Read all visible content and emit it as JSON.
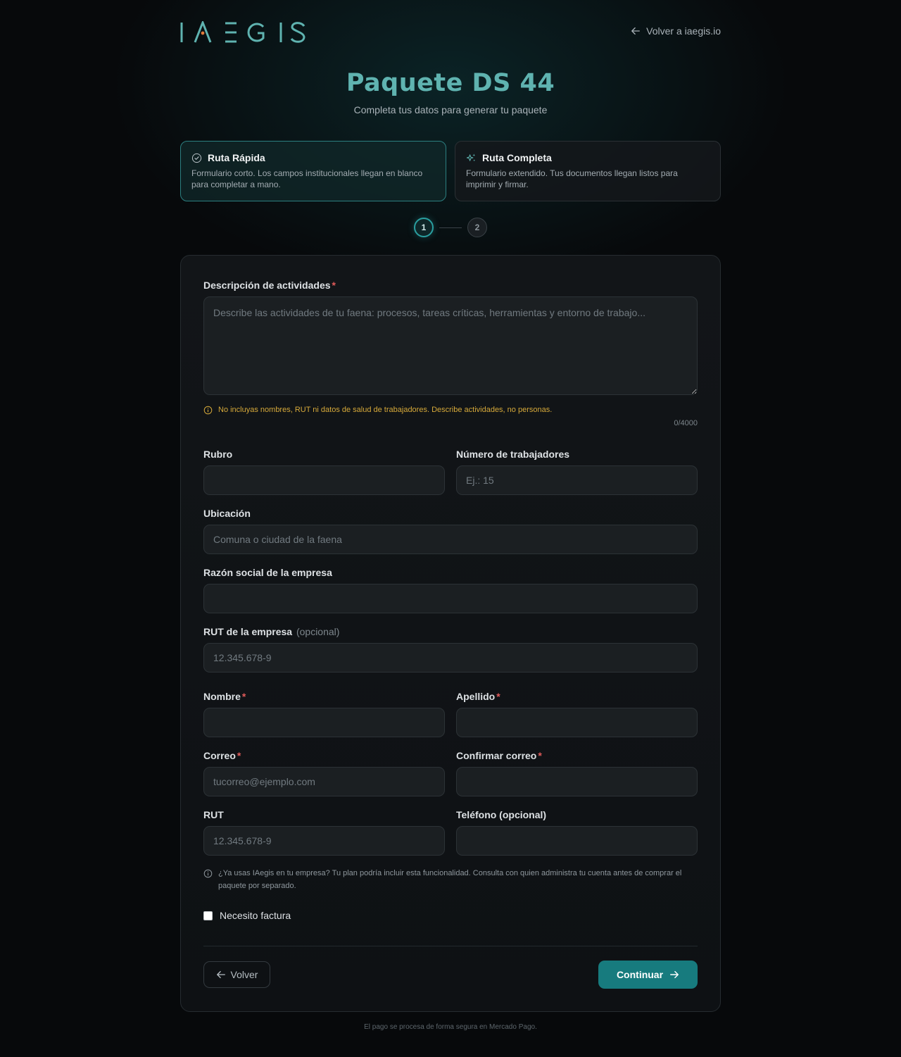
{
  "header": {
    "logo_text": "IAEGIS",
    "back_link": "Volver a iaegis.io"
  },
  "title": "Paquete DS 44",
  "subtitle": "Completa tus datos para generar tu paquete",
  "routes": [
    {
      "title": "Ruta Rápida",
      "description": "Formulario corto. Los campos institucionales llegan en blanco para completar a mano.",
      "icon": "check-circle-icon",
      "selected": true
    },
    {
      "title": "Ruta Completa",
      "description": "Formulario extendido. Tus documentos llegan listos para imprimir y firmar.",
      "icon": "sparkles-icon",
      "selected": false
    }
  ],
  "stepper": {
    "steps": [
      "1",
      "2"
    ],
    "current": 1
  },
  "form": {
    "descripcion": {
      "label": "Descripción de actividades",
      "required_mark": "*",
      "placeholder": "Describe las actividades de tu faena: procesos, tareas críticas, herramientas y entorno de trabajo...",
      "value": "",
      "warning": "No incluyas nombres, RUT ni datos de salud de trabajadores. Describe actividades, no personas.",
      "counter": "0/4000"
    },
    "rubro": {
      "label": "Rubro",
      "placeholder": "",
      "value": ""
    },
    "trabajadores": {
      "label": "Número de trabajadores",
      "placeholder": "Ej.: 15",
      "value": ""
    },
    "ubicacion": {
      "label": "Ubicación",
      "placeholder": "Comuna o ciudad de la faena",
      "value": ""
    },
    "razon_social": {
      "label": "Razón social de la empresa",
      "placeholder": "",
      "value": ""
    },
    "rut_empresa": {
      "label": "RUT de la empresa",
      "optional": "(opcional)",
      "placeholder": "12.345.678-9",
      "value": ""
    },
    "nombre": {
      "label": "Nombre",
      "required_mark": "*",
      "placeholder": "",
      "value": ""
    },
    "apellido": {
      "label": "Apellido",
      "required_mark": "*",
      "placeholder": "",
      "value": ""
    },
    "correo": {
      "label": "Correo",
      "required_mark": "*",
      "placeholder": "tucorreo@ejemplo.com",
      "value": ""
    },
    "confirmar_correo": {
      "label": "Confirmar correo",
      "required_mark": "*",
      "placeholder": "",
      "value": ""
    },
    "rut": {
      "label": "RUT",
      "placeholder": "12.345.678-9",
      "value": ""
    },
    "telefono": {
      "label": "Teléfono (opcional)",
      "placeholder": "",
      "value": ""
    },
    "info_note": "¿Ya usas IAegis en tu empresa? Tu plan podría incluir esta funcionalidad. Consulta con quien administra tu cuenta antes de comprar el paquete por separado.",
    "factura": {
      "label": "Necesito factura",
      "checked": false
    }
  },
  "actions": {
    "back": "Volver",
    "next": "Continuar"
  },
  "footer": "El pago se procesa de forma segura en Mercado Pago.",
  "colors": {
    "accent": "#5fb3b0",
    "primary_button": "#177b7e",
    "warning": "#d6a93a",
    "required": "#e05a5a",
    "background": "#07090b"
  }
}
